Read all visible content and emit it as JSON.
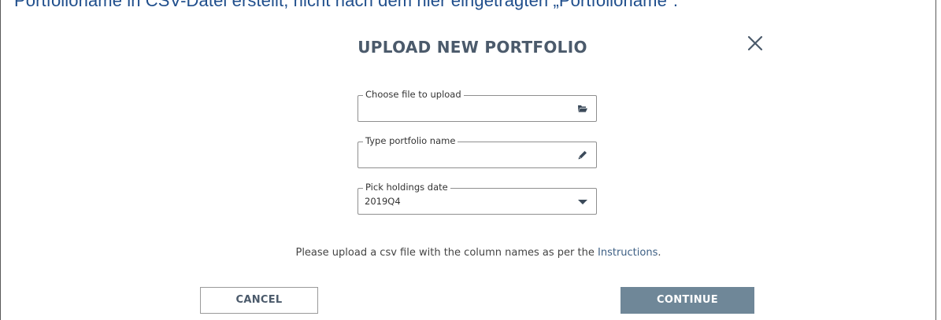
{
  "banner": {
    "text": "Portfolioname in CSV-Datei erstellt, nicht nach dem hier eingetragten „Portfolioname\"."
  },
  "modal": {
    "title": "UPLOAD NEW PORTFOLIO",
    "close_icon": "close-icon",
    "fields": {
      "file": {
        "label": "Choose file to upload",
        "value": "",
        "icon": "folder-open-icon"
      },
      "name": {
        "label": "Type portfolio name",
        "value": "",
        "icon": "pencil-icon"
      },
      "date": {
        "label": "Pick holdings date",
        "value": "2019Q4",
        "icon": "caret-down-icon"
      }
    },
    "instructions": {
      "before": "Please upload a csv file with the column names as per the ",
      "link": "Instructions",
      "after": "."
    },
    "buttons": {
      "cancel": "CANCEL",
      "continue": "CONTINUE"
    }
  },
  "colors": {
    "banner_text": "#1f4e8c",
    "title": "#4b5a6b",
    "link": "#3d5f84",
    "primary_button": "#6f8798",
    "field_border": "#8f8f8f"
  }
}
